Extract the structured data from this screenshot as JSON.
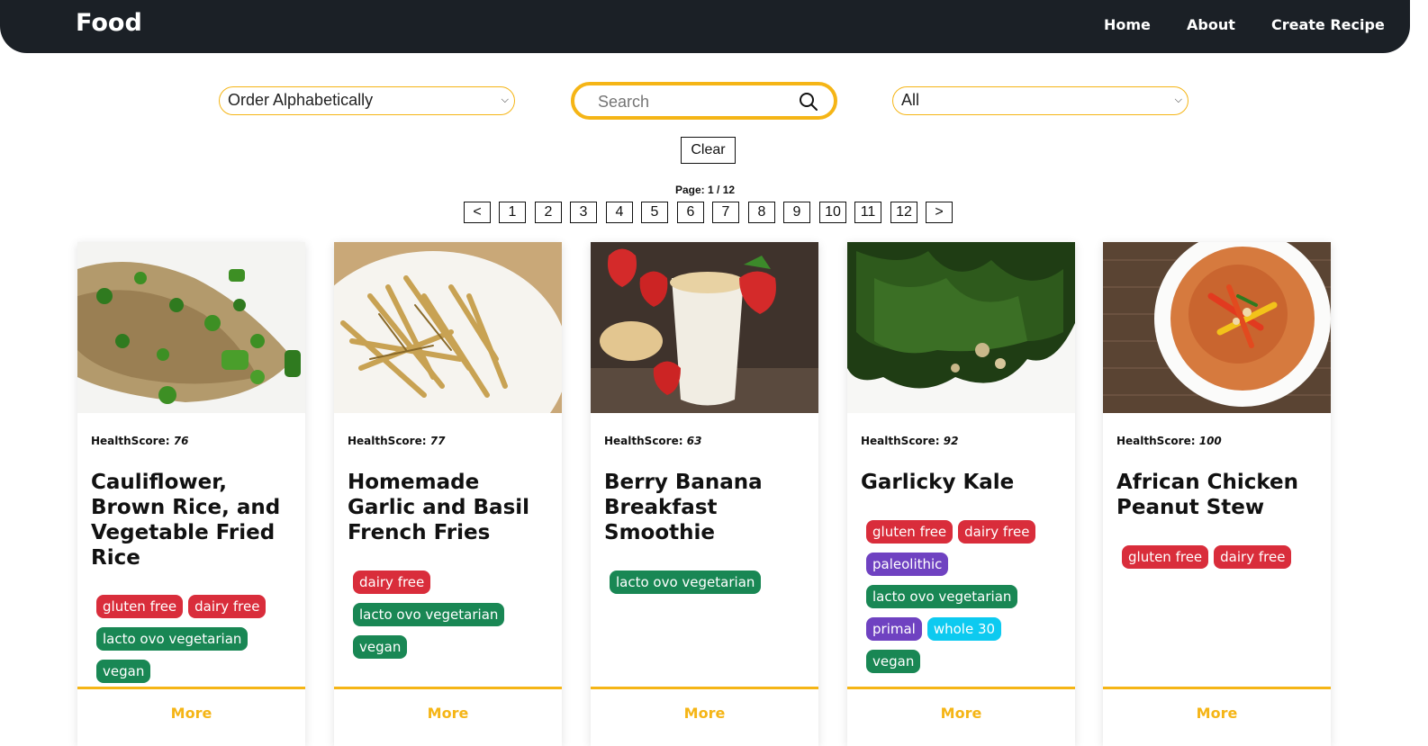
{
  "nav": {
    "brand": "Food",
    "links": [
      "Home",
      "About",
      "Create Recipe"
    ]
  },
  "filters": {
    "order_selected": "Order Alphabetically",
    "search_placeholder": "Search",
    "diet_selected": "All",
    "clear_label": "Clear"
  },
  "pagination": {
    "label": "Page: 1 / 12",
    "prev": "<",
    "next": ">",
    "pages": [
      "1",
      "2",
      "3",
      "4",
      "5",
      "6",
      "7",
      "8",
      "9",
      "10",
      "11",
      "12"
    ]
  },
  "colors": {
    "accent": "#f5b516",
    "navbar": "#1b2026",
    "tag_red": "#d92d3b",
    "tag_green": "#198754",
    "tag_purple": "#6f42c1",
    "tag_cyan": "#0dcaf0"
  },
  "cards": [
    {
      "health_label": "HealthScore:",
      "health_score": "76",
      "title": "Cauliflower, Brown Rice, and Vegetable Fried Rice",
      "diets": [
        {
          "label": "gluten free",
          "color": "red"
        },
        {
          "label": "dairy free",
          "color": "red"
        },
        {
          "label": "lacto ovo vegetarian",
          "color": "green"
        },
        {
          "label": "vegan",
          "color": "green"
        }
      ],
      "more": "More",
      "image": "fried-rice-photo"
    },
    {
      "health_label": "HealthScore:",
      "health_score": "77",
      "title": "Homemade Garlic and Basil French Fries",
      "diets": [
        {
          "label": "dairy free",
          "color": "red"
        },
        {
          "label": "lacto ovo vegetarian",
          "color": "green"
        },
        {
          "label": "vegan",
          "color": "green"
        }
      ],
      "more": "More",
      "image": "french-fries-photo"
    },
    {
      "health_label": "HealthScore:",
      "health_score": "63",
      "title": "Berry Banana Breakfast Smoothie",
      "diets": [
        {
          "label": "lacto ovo vegetarian",
          "color": "green"
        }
      ],
      "more": "More",
      "image": "smoothie-photo"
    },
    {
      "health_label": "HealthScore:",
      "health_score": "92",
      "title": "Garlicky Kale",
      "diets": [
        {
          "label": "gluten free",
          "color": "red"
        },
        {
          "label": "dairy free",
          "color": "red"
        },
        {
          "label": "paleolithic",
          "color": "purple"
        },
        {
          "label": "lacto ovo vegetarian",
          "color": "green"
        },
        {
          "label": "primal",
          "color": "purple"
        },
        {
          "label": "whole 30",
          "color": "cyan"
        },
        {
          "label": "vegan",
          "color": "green"
        }
      ],
      "more": "More",
      "image": "kale-photo"
    },
    {
      "health_label": "HealthScore:",
      "health_score": "100",
      "title": "African Chicken Peanut Stew",
      "diets": [
        {
          "label": "gluten free",
          "color": "red"
        },
        {
          "label": "dairy free",
          "color": "red"
        }
      ],
      "more": "More",
      "image": "peanut-stew-photo"
    }
  ]
}
